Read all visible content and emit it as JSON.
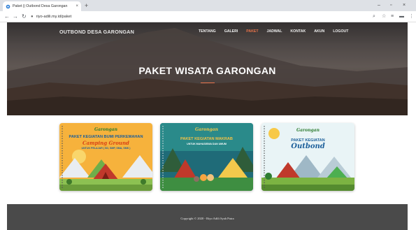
{
  "browser": {
    "tab_title": "Paket || Outbond Desa Garongan",
    "tab_close": "×",
    "new_tab": "+",
    "url": "riyo-adili.my.id/paket",
    "window_controls": {
      "minimize": "–",
      "maximize": "▫",
      "close": "×"
    },
    "icons": [
      "back-icon",
      "forward-icon",
      "reload-icon",
      "lock-icon",
      "zoom-icon",
      "star-icon",
      "media-icon",
      "extension-icon",
      "menu-icon"
    ]
  },
  "navbar": {
    "brand": "OUTBOND DESA GARONGAN",
    "items": [
      {
        "label": "TENTANG",
        "active": false
      },
      {
        "label": "GALERI",
        "active": false
      },
      {
        "label": "PAKET",
        "active": true
      },
      {
        "label": "JADWAL",
        "active": false
      },
      {
        "label": "KONTAK",
        "active": false
      },
      {
        "label": "AKUN",
        "active": false
      },
      {
        "label": "LOGOUT",
        "active": false
      }
    ]
  },
  "hero": {
    "title": "PAKET WISATA GARONGAN"
  },
  "cards": [
    {
      "logo": "Garongan",
      "line1": "PAKET KEGIATAN BUMI PERKEMAHAN",
      "line2": "Camping Ground",
      "line3": "UNTUK PELAJAR ( SD, SMP, SMA, SMK )"
    },
    {
      "logo": "Garongan",
      "line1": "PAKET KEGIATAN MAKRAB",
      "line2": "",
      "line3": "UNTUK MAHASISWA DAN UMUM"
    },
    {
      "logo": "Garongan",
      "line1": "PAKET KEGIATAN",
      "line2": "Outbond",
      "line3": ""
    }
  ],
  "footer": {
    "copyright": "Copyright © 2020 - Riyo Adili Syah Putra"
  },
  "colors": {
    "accent": "#e8734a",
    "footer_bg": "#4a4a4a",
    "card1_bg": "#f6b23c",
    "card2_bg": "#1f6b78",
    "card3_bg": "#e9f4f6"
  }
}
